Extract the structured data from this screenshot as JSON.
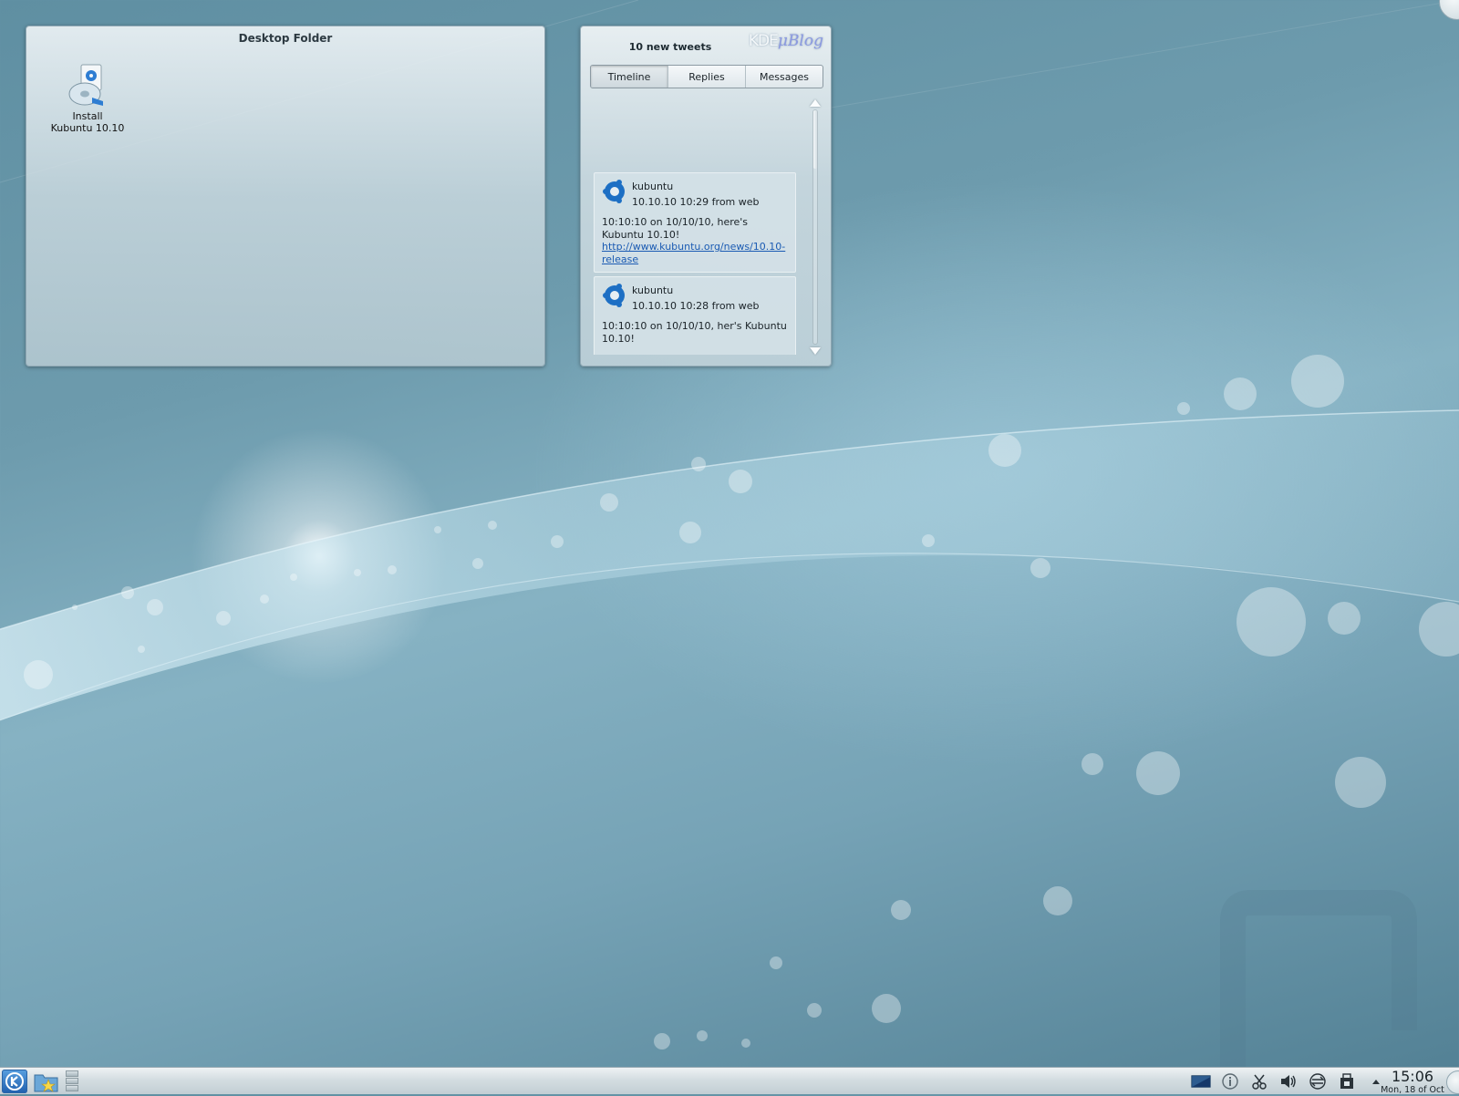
{
  "desktop_folder": {
    "title": "Desktop Folder",
    "icons": [
      {
        "label": "Install Kubuntu 10.10",
        "icon": "install-cd-icon"
      }
    ]
  },
  "microblog": {
    "header": "10 new tweets",
    "logo_kde": "KDE",
    "logo_ublog": "μBlog",
    "tabs": [
      {
        "label": "Timeline",
        "active": true
      },
      {
        "label": "Replies",
        "active": false
      },
      {
        "label": "Messages",
        "active": false
      }
    ],
    "tweets": [
      {
        "user": "kubuntu",
        "meta": "10.10.10 10:29 from web",
        "text": "10:10:10 on 10/10/10, here's Kubuntu 10.10!",
        "link": "http://www.kubuntu.org/news/10.10-release",
        "avatar": "kubuntu-logo-icon"
      },
      {
        "user": "kubuntu",
        "meta": "10.10.10 10:28 from web",
        "text": "10:10:10 on 10/10/10, her's Kubuntu 10.10!",
        "link": "",
        "avatar": "kubuntu-logo-icon"
      }
    ]
  },
  "panel": {
    "clock_time": "15:06",
    "clock_date": "Mon, 18 of Oct",
    "tray_icons": [
      "screen-icon",
      "info-icon",
      "clipboard-scissors-icon",
      "volume-icon",
      "network-icon",
      "device-notifier-icon",
      "tray-expand-icon"
    ]
  },
  "colors": {
    "accent": "#1f5fae",
    "link": "#1b5bb3"
  }
}
